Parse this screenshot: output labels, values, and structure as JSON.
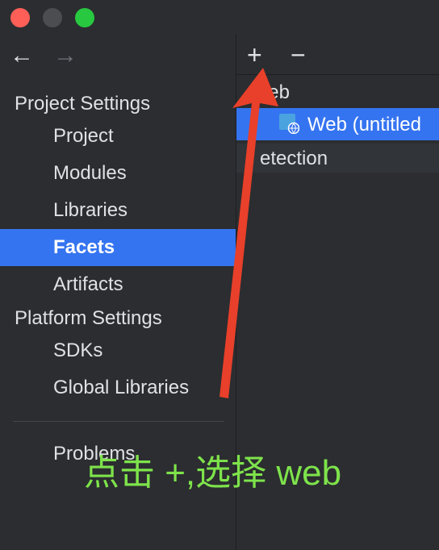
{
  "window": {
    "controls": [
      "close",
      "minimize",
      "zoom"
    ]
  },
  "navigation": {
    "back_glyph": "←",
    "forward_glyph": "→"
  },
  "sidebar": {
    "groups": [
      {
        "label": "Project Settings",
        "items": [
          {
            "label": "Project"
          },
          {
            "label": "Modules"
          },
          {
            "label": "Libraries"
          },
          {
            "label": "Facets",
            "selected": true
          },
          {
            "label": "Artifacts"
          }
        ]
      },
      {
        "label": "Platform Settings",
        "items": [
          {
            "label": "SDKs"
          },
          {
            "label": "Global Libraries"
          }
        ]
      }
    ],
    "problems_label": "Problems"
  },
  "facets_panel": {
    "toolbar": {
      "add_glyph": "+",
      "remove_glyph": "−"
    },
    "tree": {
      "group_label": "Web",
      "item_label": "Web (untitled",
      "item_icon": "web-module-icon",
      "detection_label": "etection"
    }
  },
  "annotation": {
    "text": "点击 +,选择 web",
    "color": "#7ee34b",
    "arrow_color": "#e8402a"
  },
  "colors": {
    "background": "#2b2d30",
    "selection": "#3574f0",
    "text": "#dfe1e5"
  }
}
